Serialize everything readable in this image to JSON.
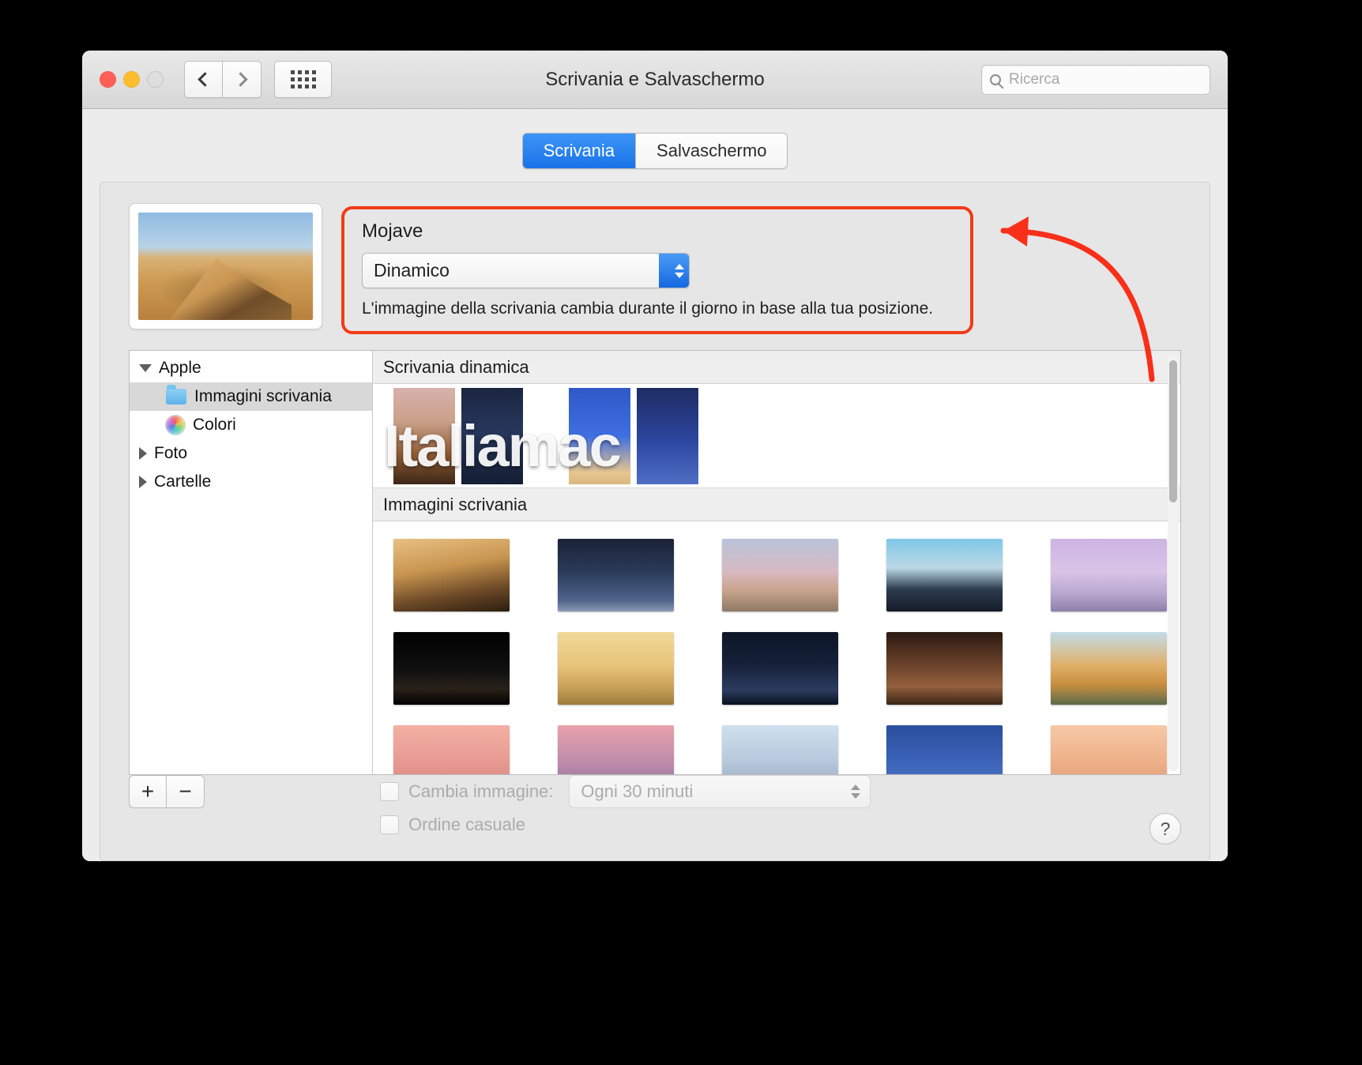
{
  "window": {
    "title": "Scrivania e Salvaschermo",
    "search_placeholder": "Ricerca",
    "traffic": {
      "close": "close-button",
      "minimize": "minimize-button",
      "zoom": "zoom-button"
    },
    "nav": {
      "back": "back-button",
      "forward": "forward-button",
      "grid": "show-all-button"
    }
  },
  "tabs": [
    {
      "label": "Scrivania",
      "active": true
    },
    {
      "label": "Salvaschermo",
      "active": false
    }
  ],
  "info": {
    "title": "Mojave",
    "popup_value": "Dinamico",
    "description": "L'immagine della scrivania cambia durante il giorno in base alla tua posizione."
  },
  "sidebar": {
    "items": [
      {
        "label": "Apple",
        "level": 0,
        "disclosure": "open",
        "icon": "none",
        "selected": false
      },
      {
        "label": "Immagini scrivania",
        "level": 1,
        "disclosure": "none",
        "icon": "folder-icon",
        "selected": true
      },
      {
        "label": "Colori",
        "level": 1,
        "disclosure": "none",
        "icon": "color-wheel-icon",
        "selected": false
      },
      {
        "label": "Foto",
        "level": 0,
        "disclosure": "closed",
        "icon": "none",
        "selected": false
      },
      {
        "label": "Cartelle",
        "level": 0,
        "disclosure": "closed",
        "icon": "none",
        "selected": false
      }
    ]
  },
  "content": {
    "section_dynamic": "Scrivania dinamica",
    "section_images": "Immagini scrivania",
    "watermark": "Italiamac",
    "dynamic_thumbs": [
      "linear-gradient(180deg,#d8b1ac 0%,#c9a089 35%,#8e5b33 70%,#3c2616 100%)",
      "linear-gradient(180deg,#1b2540 0%,#27375c 45%,#141d33 100%)",
      "linear-gradient(180deg,#2f58c8 0%,#3f6fe0 50%,#e7c68f 88%,#d9b87f 100%)",
      "linear-gradient(180deg,#1e2c63 0%,#2d47a0 55%,#4f6ec4 100%)"
    ],
    "image_thumbs": [
      "linear-gradient(170deg,#e8c083 0%,#c89550 40%,#6d4a27 72%,#2c1d0f 100%)",
      "linear-gradient(180deg,#1a2238 0%,#2a3a59 45%,#4e6489 85%,#8b9bb5 100%)",
      "linear-gradient(180deg,#b9c3da 0%,#d7b9c2 45%,#caa48e 70%,#8e7a66 100%)",
      "linear-gradient(180deg,#7fc7e8 0%,#bcd8e6 40%,#2a3a4d 70%,#151c28 100%)",
      "linear-gradient(180deg,#cdb4e2 0%,#d9c4e8 45%,#b9a7cf 75%,#8f7fa8 100%)",
      "linear-gradient(180deg,#000000 0%,#111111 55%,#2a2218 78%,#000000 100%)",
      "linear-gradient(180deg,#f0d99a 0%,#e8c579 45%,#caa358 75%,#9d7b3d 100%)",
      "linear-gradient(180deg,#0d1626 0%,#16213a 45%,#2b3c5e 80%,#0a1120 100%)",
      "linear-gradient(180deg,#2b1a12 0%,#6b422a 45%,#93603c 75%,#3a2518 100%)",
      "linear-gradient(180deg,#c2ddea 0%,#e0b06a 45%,#c98f3f 72%,#5c6b4a 100%)",
      "linear-gradient(180deg,#f3b0a3 0%,#e89a92 50%,#cf8078 100%)",
      "linear-gradient(180deg,#e9a2ab 0%,#b98aa8 55%,#7a6a94 100%)",
      "linear-gradient(180deg,#cfe0ee 0%,#b7c8dc 50%,#8fa2b8 100%)",
      "linear-gradient(180deg,#2b4f9e 0%,#3b63b8 50%,#5478c7 100%)",
      "linear-gradient(180deg,#f6c9a6 0%,#eeb089 50%,#d99870 100%)"
    ]
  },
  "bottom": {
    "add_label": "+",
    "remove_label": "−",
    "change_image_label": "Cambia immagine:",
    "interval_value": "Ogni 30 minuti",
    "random_order_label": "Ordine casuale",
    "help_label": "?"
  },
  "annotation": {
    "highlight_color": "#f23b16",
    "arrow_color": "#f8301a"
  }
}
